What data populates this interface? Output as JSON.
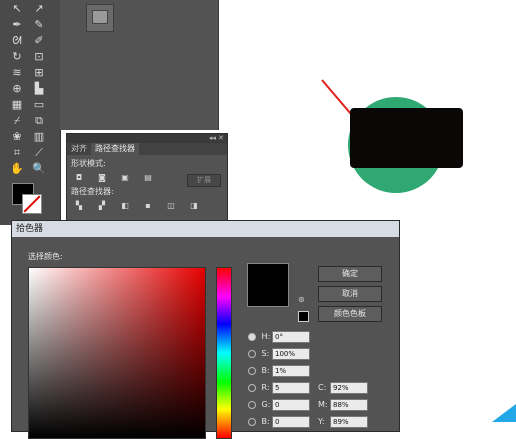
{
  "app": {
    "accent_color": "#e60000",
    "shape_green": "#2fa871",
    "shape_black": "#0a0707"
  },
  "pathfinder_panel": {
    "tabs": [
      {
        "label": "对齐"
      },
      {
        "label": "路径查找器"
      }
    ],
    "shape_modes_label": "形状模式:",
    "expand_label": "扩展",
    "pathfinders_label": "路径查找器:"
  },
  "color_picker": {
    "title": "拾色器",
    "select_color_label": "选择颜色:",
    "ok_label": "确定",
    "cancel_label": "取消",
    "swatches_label": "颜色色板",
    "fields": [
      {
        "label": "H:",
        "value": "0°",
        "selected": true
      },
      {
        "label": "S:",
        "value": "100%",
        "selected": false
      },
      {
        "label": "B:",
        "value": "1%",
        "selected": false
      },
      {
        "label": "R:",
        "value": "5",
        "selected": false
      },
      {
        "label": "G:",
        "value": "0",
        "selected": false
      },
      {
        "label": "B:",
        "value": "0",
        "selected": false
      }
    ],
    "cmyk": [
      {
        "label": "C:",
        "value": "92%"
      },
      {
        "label": "M:",
        "value": "88%"
      },
      {
        "label": "Y:",
        "value": "89%"
      }
    ],
    "current_color": "#000000"
  }
}
